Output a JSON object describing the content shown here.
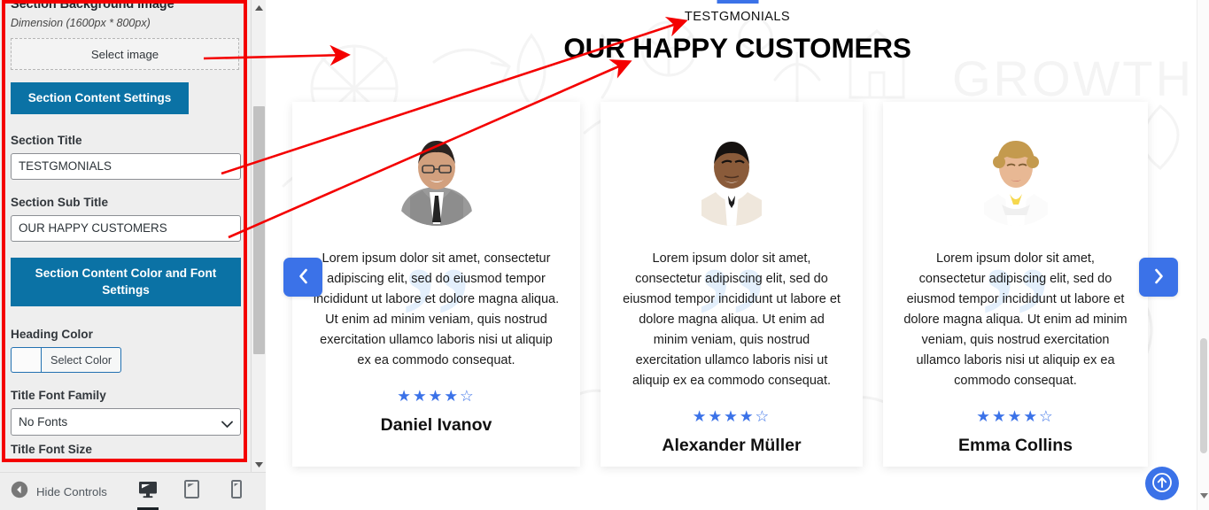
{
  "sidebar": {
    "panel_heading": "Section Background Image",
    "dimension_note": "Dimension (1600px * 800px)",
    "select_image_label": "Select image",
    "content_settings_button": "Section Content Settings",
    "section_title_label": "Section Title",
    "section_title_value": "TESTGMONIALS",
    "section_subtitle_label": "Section Sub Title",
    "section_subtitle_value": "OUR HAPPY CUSTOMERS",
    "color_font_settings_button": "Section Content Color and Font Settings",
    "heading_color_label": "Heading Color",
    "select_color_label": "Select Color",
    "title_font_family_label": "Title Font Family",
    "title_font_family_value": "No Fonts",
    "font_options": [
      "No Fonts"
    ],
    "cut_off_label": "Title Font Size",
    "accent_button_color": "#0b72a5",
    "highlight_color": "#f40000"
  },
  "bottom_bar": {
    "hide_controls_label": "Hide Controls",
    "devices": [
      {
        "name": "desktop",
        "active": true
      },
      {
        "name": "tablet",
        "active": false
      },
      {
        "name": "mobile",
        "active": false
      }
    ]
  },
  "preview": {
    "section_title": "TESTGMONIALS",
    "section_subtitle": "OUR HAPPY CUSTOMERS",
    "accent_color": "#3b72e8",
    "prev_label": "Previous",
    "next_label": "Next",
    "scroll_top_label": "Scroll to top",
    "background_watermark_text": "GROWTH",
    "testimonials": [
      {
        "name": "Daniel Ivanov",
        "quote": "Lorem ipsum dolor sit amet, consectetur adipiscing elit, sed do eiusmod tempor incididunt ut labore et dolore magna aliqua. Ut enim ad minim veniam, quis nostrud exercitation ullamco laboris nisi ut aliquip ex ea commodo consequat.",
        "rating": 4,
        "max_rating": 5
      },
      {
        "name": "Alexander Müller",
        "quote": "Lorem ipsum dolor sit amet, consectetur adipiscing elit, sed do eiusmod tempor incididunt ut labore et dolore magna aliqua. Ut enim ad minim veniam, quis nostrud exercitation ullamco laboris nisi ut aliquip ex ea commodo consequat.",
        "rating": 4,
        "max_rating": 5
      },
      {
        "name": "Emma Collins",
        "quote": "Lorem ipsum dolor sit amet, consectetur adipiscing elit, sed do eiusmod tempor incididunt ut labore et dolore magna aliqua. Ut enim ad minim veniam, quis nostrud exercitation ullamco laboris nisi ut aliquip ex ea commodo consequat.",
        "rating": 4,
        "max_rating": 5
      }
    ]
  }
}
